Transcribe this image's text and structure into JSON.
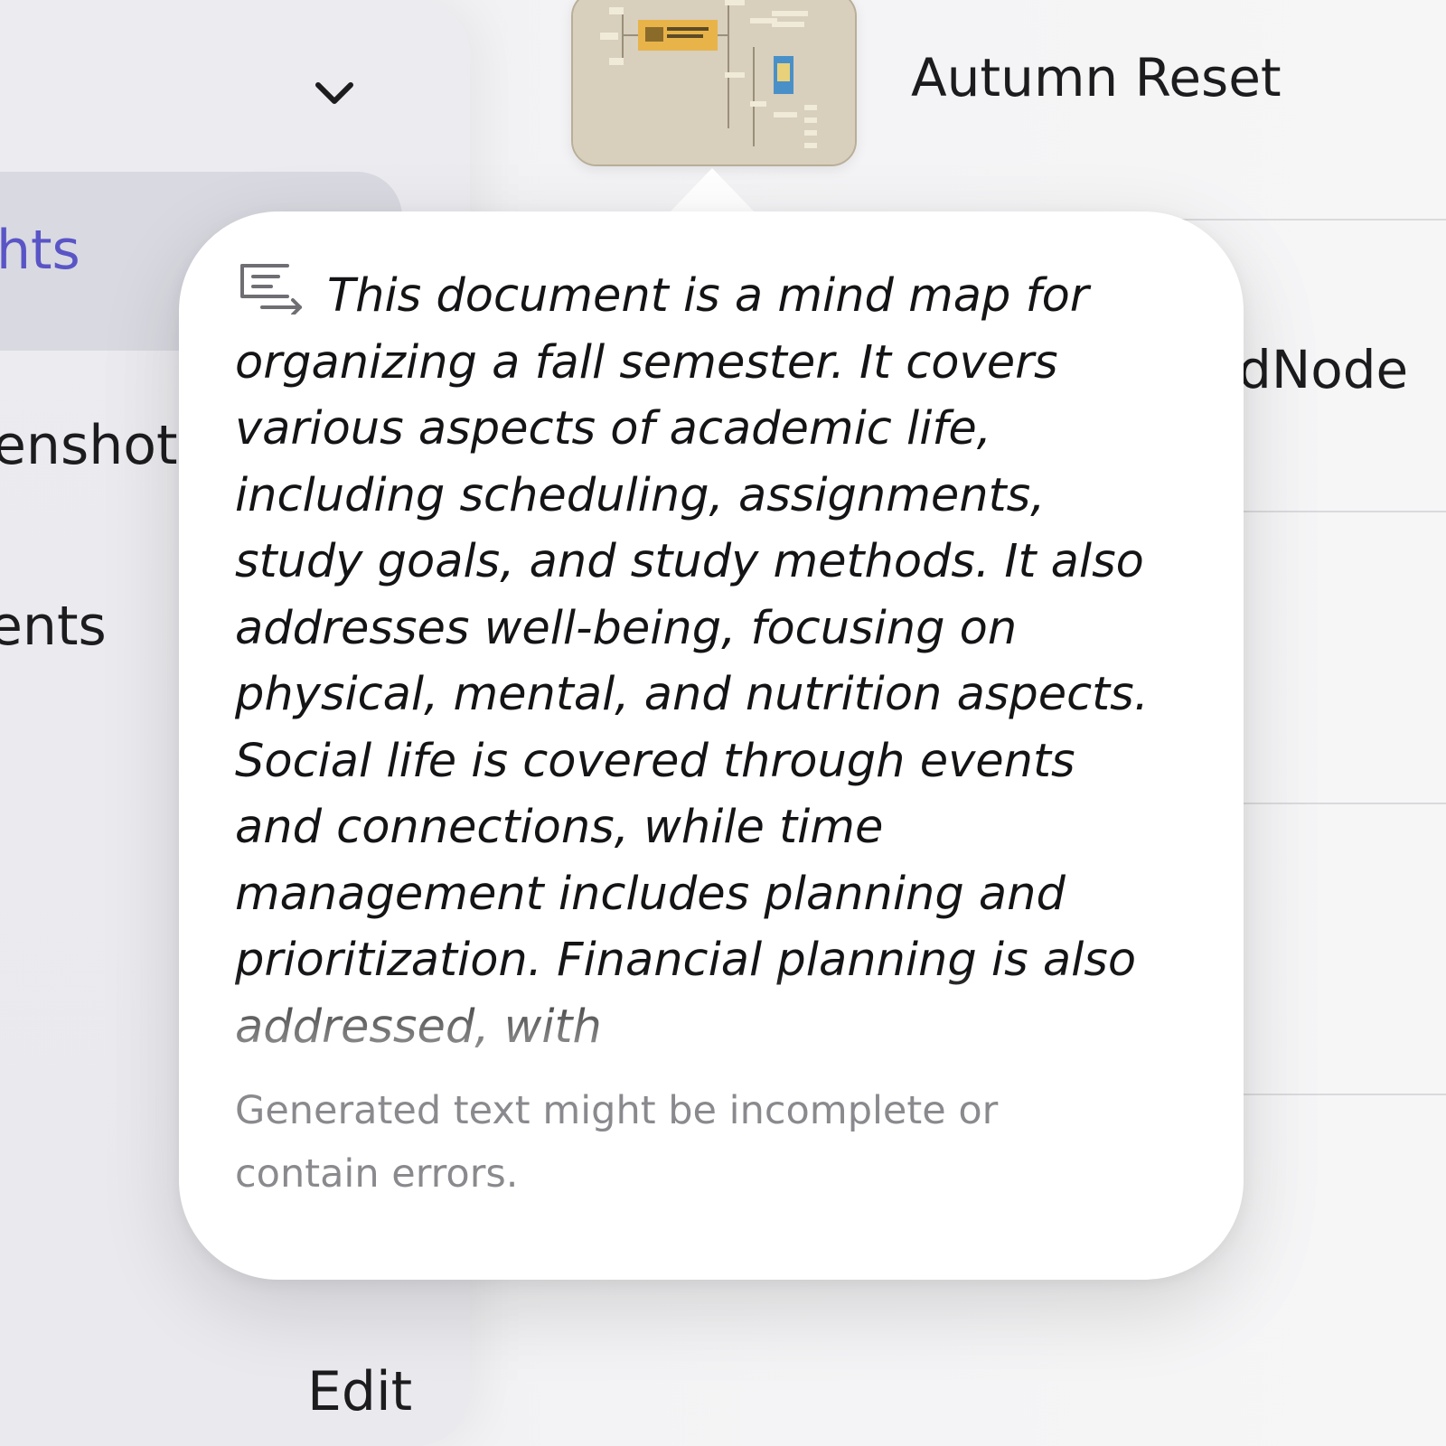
{
  "sidebar": {
    "chevron_icon": "chevron-down-icon",
    "items": [
      {
        "label": "hts",
        "selected": true
      },
      {
        "label": "enshots",
        "selected": false
      },
      {
        "label": "ents",
        "selected": false
      }
    ],
    "edit_label": "Edit",
    "accent_color": "#5a55c6"
  },
  "documents": [
    {
      "title": "Autumn Reset"
    },
    {
      "title": "dNode"
    }
  ],
  "popover": {
    "icon": "summary-icon",
    "summary_text": "This document is a mind map for organizing a fall semester. It covers various aspects of academic life, including scheduling, assignments, study goals, and study methods. It also addresses well-being, focusing on physical, mental, and nutrition aspects. Social life is covered through events and connections, while time management includes planning and prioritization. Financial planning is also addressed, with",
    "disclaimer": "Generated text might be incomplete or contain errors."
  }
}
